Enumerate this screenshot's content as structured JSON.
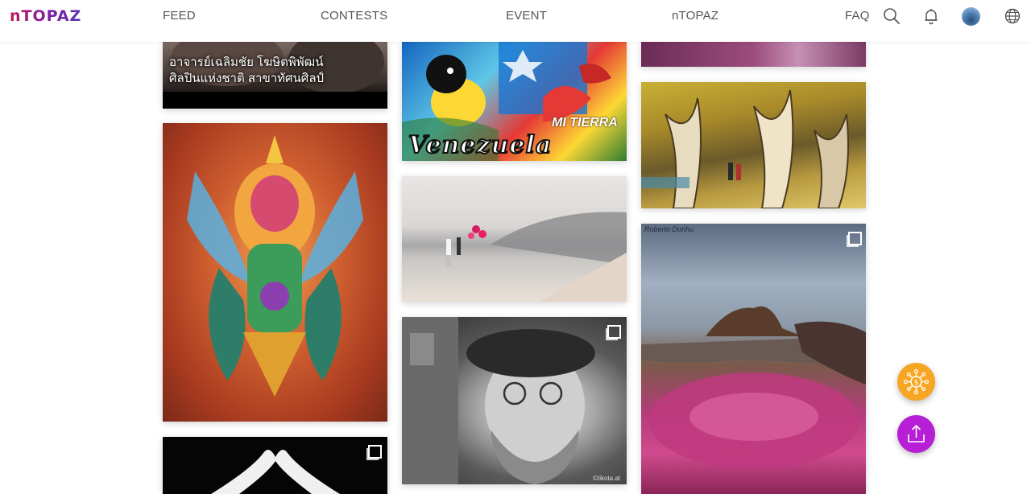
{
  "header": {
    "logo": "nTOPAZ",
    "nav": {
      "feed": "FEED",
      "contests": "CONTESTS",
      "event": "EVENT",
      "ntopaz": "nTOPAZ",
      "faq": "FAQ"
    },
    "icons": [
      "search-icon",
      "bell-icon",
      "avatar",
      "globe-icon"
    ]
  },
  "feed": {
    "card_1": {
      "caption_line_1": "อาจารย์เฉลิมชัย โฆษิตพิพัฒน์",
      "caption_line_2": "ศิลปินแห่งชาติ สาขาทัศนศิลป์"
    },
    "card_2": {
      "text_main": "Venezuela",
      "text_small": "MI TIERRA"
    },
    "card_7": {
      "signature": "Roberto Donhu"
    },
    "card_8": {
      "credit": "©tikota.at"
    }
  },
  "actions": {
    "sell_icon": "network-dollar-icon",
    "upload_icon": "upload-icon"
  },
  "colors": {
    "logo_gradient_start": "#c2185b",
    "logo_gradient_end": "#5e35b1",
    "fab_sell": "#f6a623",
    "fab_upload": "#b71fd6"
  }
}
